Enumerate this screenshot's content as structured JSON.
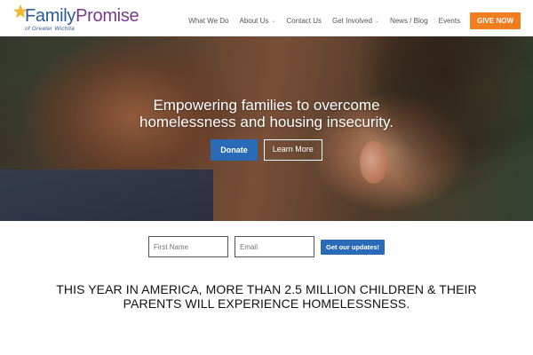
{
  "logo": {
    "name_part1": "Family",
    "name_part2": "Promise",
    "subtitle": "of Greater Wichita"
  },
  "nav": {
    "items": [
      {
        "label": "What We Do",
        "has_dropdown": false
      },
      {
        "label": "About Us",
        "has_dropdown": true
      },
      {
        "label": "Contact Us",
        "has_dropdown": false
      },
      {
        "label": "Get Involved",
        "has_dropdown": true
      },
      {
        "label": "News / Blog",
        "has_dropdown": false
      },
      {
        "label": "Events",
        "has_dropdown": false
      }
    ],
    "cta_label": "GIVE NOW",
    "dropdown_glyph": "⌄"
  },
  "hero": {
    "line1": "Empowering families to overcome",
    "line2": "homelessness and housing insecurity.",
    "donate_label": "Donate",
    "learn_more_label": "Learn More"
  },
  "signup": {
    "first_name_placeholder": "First Name",
    "email_placeholder": "Email",
    "submit_label": "Get our updates!"
  },
  "headline": {
    "line1": "THIS YEAR IN AMERICA, MORE THAN 2.5 MILLION CHILDREN & THEIR",
    "line2": "PARENTS WILL EXPERIENCE HOMELESSNESS."
  },
  "colors": {
    "brand_blue": "#2a6bb8",
    "cta_orange": "#f07d1e",
    "logo_purple": "#7a3a8c"
  }
}
